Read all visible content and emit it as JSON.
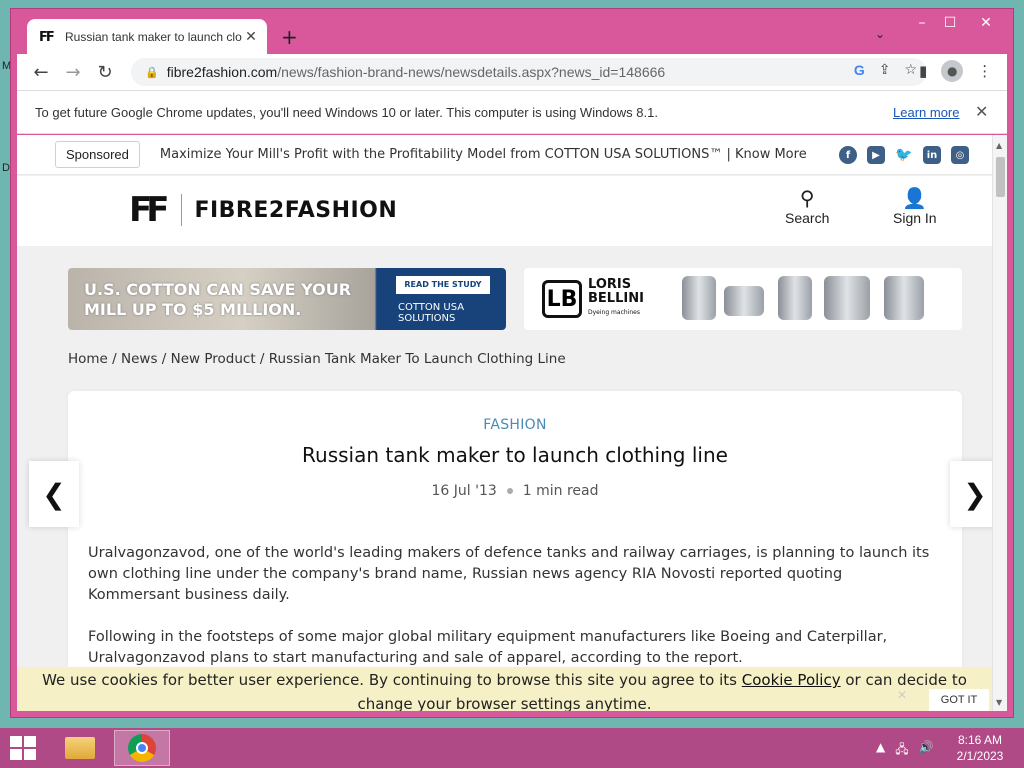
{
  "browser": {
    "tab_title": "Russian tank maker to launch clo",
    "tab_favicon": "FF",
    "url_host": "fibre2fashion.com",
    "url_path": "/news/fashion-brand-news/newsdetails.aspx?news_id=148666"
  },
  "infobar": {
    "message": "To get future Google Chrome updates, you'll need Windows 10 or later. This computer is using Windows 8.1.",
    "learn_more": "Learn more"
  },
  "sponsor": {
    "badge": "Sponsored",
    "text": "Maximize Your Mill's Profit with the Profitability Model from COTTON USA SOLUTIONS™ | Know More"
  },
  "header": {
    "logo_mark": "FF",
    "logo_text": "FIBRE2FASHION",
    "search_label": "Search",
    "signin_label": "Sign In"
  },
  "ads": {
    "left_headline_1": "U.S. COTTON CAN SAVE YOUR",
    "left_headline_2": "MILL UP TO $5 MILLION.",
    "left_cta": "READ THE STUDY",
    "left_brand_1": "COTTON USA",
    "left_brand_2": "SOLUTIONS",
    "right_brand_1": "LORIS",
    "right_brand_2": "BELLINI",
    "right_brand_sub": "Dyeing machines"
  },
  "breadcrumb": {
    "home": "Home",
    "news": "News",
    "new_product": "New Product",
    "current": "Russian Tank Maker To Launch Clothing Line"
  },
  "article": {
    "category": "FASHION",
    "title": "Russian tank maker to launch clothing line",
    "date": "16 Jul '13",
    "read_time": "1 min read",
    "para1": "Uralvagonzavod, one of the world's leading makers of defence tanks and railway carriages, is planning to launch its own clothing line under the company's brand name, Russian news agency RIA Novosti reported quoting Kommersant business daily.",
    "para2": "Following in the footsteps of some major global military equipment manufacturers like Boeing and Caterpillar, Uralvagonzavod plans to start manufacturing and sale of apparel, according to the report."
  },
  "cookie": {
    "before": "We use cookies for better user experience. By continuing to browse this site you agree to its ",
    "link": "Cookie Policy",
    "after": " or can decide to change your browser settings anytime.",
    "button": "GOT IT"
  },
  "taskbar": {
    "time": "8:16 AM",
    "date": "2/1/2023"
  },
  "colors": {
    "window_frame": "#d9589b",
    "taskbar": "#b04a86",
    "category_blue": "#4a8bb5",
    "cookie_bg": "#f6f0c6"
  }
}
